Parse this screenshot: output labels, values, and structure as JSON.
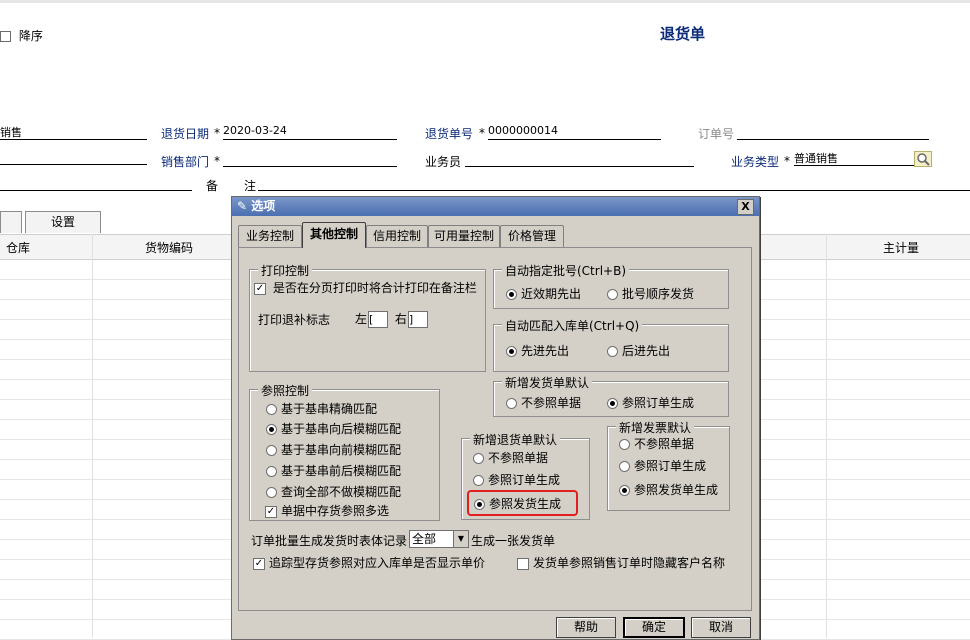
{
  "header": {
    "sort_label": "降序",
    "title": "退货单"
  },
  "form": {
    "customer_value": "销售",
    "return_date_label": "退货日期",
    "return_date_value": "2020-03-24",
    "return_no_label": "退货单号",
    "return_no_value": "0000000014",
    "order_no_label": "订单号",
    "dept_label": "销售部门",
    "salesman_label": "业务员",
    "biz_type_label": "业务类型",
    "biz_type_value": "普通销售",
    "remark_label_1": "备",
    "remark_label_2": "注",
    "required_mark": "*"
  },
  "background": {
    "settings_tab": "设置",
    "col_warehouse": "仓库",
    "col_item_code": "货物编码",
    "col_main_unit": "主计量"
  },
  "dialog": {
    "title": "选项",
    "close": "X",
    "tabs": [
      "业务控制",
      "其他控制",
      "信用控制",
      "可用量控制",
      "价格管理"
    ],
    "print_group": {
      "title": "打印控制",
      "checkbox_label": "是否在分页打印时将合计打印在备注栏",
      "flag_label": "打印退补标志",
      "left_label": "左",
      "right_label": "右",
      "left_value": "[",
      "right_value": "]"
    },
    "auto_batch": {
      "title": "自动指定批号(Ctrl+B)",
      "options": [
        "近效期先出",
        "批号顺序发货"
      ]
    },
    "auto_match": {
      "title": "自动匹配入库单(Ctrl+Q)",
      "options": [
        "先进先出",
        "后进先出"
      ]
    },
    "new_delivery": {
      "title": "新增发货单默认",
      "options": [
        "不参照单据",
        "参照订单生成"
      ]
    },
    "ref_group": {
      "title": "参照控制",
      "options": [
        "基于基串精确匹配",
        "基于基串向后模糊匹配",
        "基于基串向前模糊匹配",
        "基于基串前后模糊匹配",
        "查询全部不做模糊匹配"
      ],
      "checkbox_label": "单据中存货参照多选"
    },
    "new_return": {
      "title": "新增退货单默认",
      "options": [
        "不参照单据",
        "参照订单生成",
        "参照发货生成"
      ]
    },
    "new_invoice": {
      "title": "新增发票默认",
      "options": [
        "不参照单据",
        "参照订单生成",
        "参照发货单生成"
      ]
    },
    "batch_gen": {
      "prefix": "订单批量生成发货时表体记录",
      "select_value": "全部",
      "suffix": "生成一张发货单"
    },
    "checkbox_track": "追踪型存货参照对应入库单是否显示单价",
    "checkbox_hide": "发货单参照销售订单时隐藏客户名称",
    "check_mark": "✓",
    "buttons": {
      "help": "帮助",
      "ok": "确定",
      "cancel": "取消"
    }
  }
}
